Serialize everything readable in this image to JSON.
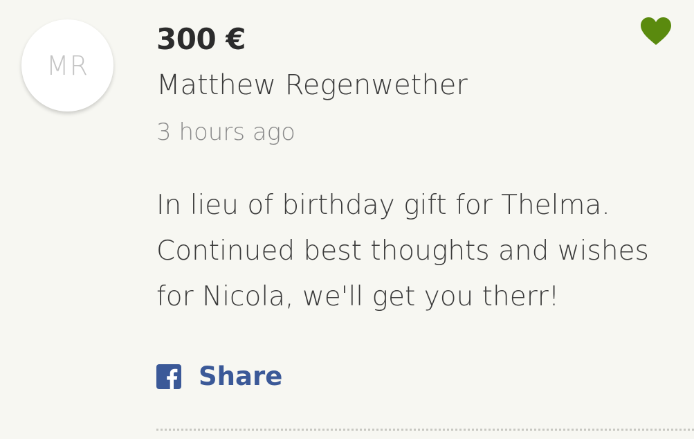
{
  "donation": {
    "avatar_initials": "MR",
    "amount": "300 €",
    "donor_name": "Matthew Regenwether",
    "time_ago": "3 hours ago",
    "message": "In lieu of birthday gift for Thelma. Continued best thoughts and wishes for Nicola, we'll get you therr!",
    "share_label": "Share",
    "share_icon": "facebook-icon",
    "like_icon": "heart-icon"
  },
  "colors": {
    "background": "#f7f7f2",
    "heart": "#5a8a0e",
    "facebook": "#3b5998",
    "text": "#3a3a3a",
    "muted": "#8a8a8a"
  }
}
